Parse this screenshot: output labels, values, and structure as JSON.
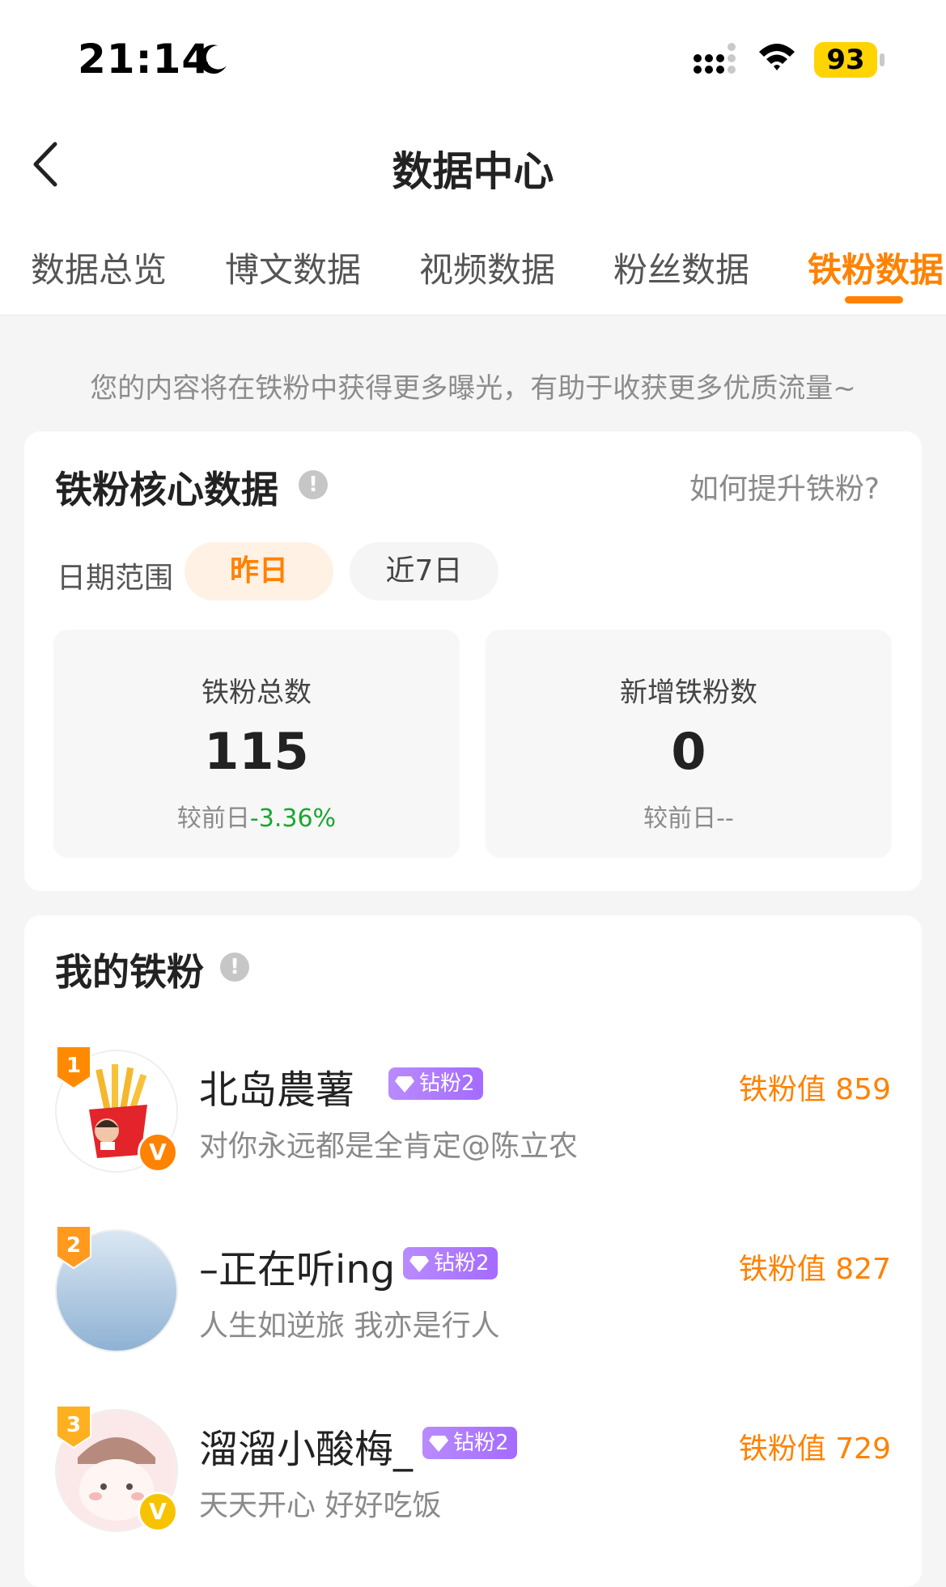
{
  "status_bar": {
    "time": "21:14",
    "battery": "93"
  },
  "nav": {
    "title": "数据中心"
  },
  "tabs": [
    {
      "label": "数据总览"
    },
    {
      "label": "博文数据"
    },
    {
      "label": "视频数据"
    },
    {
      "label": "粉丝数据"
    },
    {
      "label": "铁粉数据",
      "active": true
    }
  ],
  "notice": "您的内容将在铁粉中获得更多曝光，有助于收获更多优质流量~",
  "core_card": {
    "title": "铁粉核心数据",
    "help_link": "如何提升铁粉?",
    "date_label": "日期范围",
    "date_options": [
      "昨日",
      "近7日"
    ],
    "selected_option": "昨日",
    "stats": [
      {
        "label": "铁粉总数",
        "value": "115",
        "compare_prefix": "较前日",
        "compare_value": "-3.36%"
      },
      {
        "label": "新增铁粉数",
        "value": "0",
        "compare_prefix": "较前日",
        "compare_value": "--"
      }
    ]
  },
  "fans_card": {
    "title": "我的铁粉",
    "fans": [
      {
        "rank": "1",
        "name": "北岛農薯",
        "tag": "钻粉2",
        "desc": "对你永远都是全肯定@陈立农",
        "score": "铁粉值 859",
        "verified": true
      },
      {
        "rank": "2",
        "name": "–正在听ing",
        "tag": "钻粉2",
        "desc": "人生如逆旅 我亦是行人",
        "score": "铁粉值 827",
        "verified": false
      },
      {
        "rank": "3",
        "name": "溜溜小酸梅_",
        "tag": "钻粉2",
        "desc": "天天开心 好好吃饭",
        "score": "铁粉值 729",
        "verified": true
      }
    ]
  },
  "colors": {
    "accent": "#ff8200",
    "positive_change": "#1aa632",
    "tag_purple": "#a46bff"
  }
}
